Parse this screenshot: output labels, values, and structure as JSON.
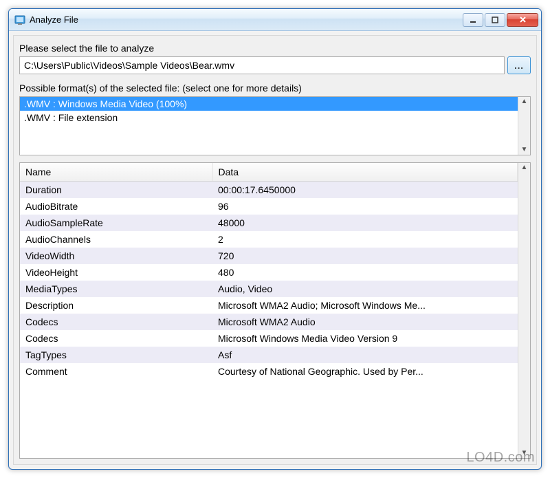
{
  "window": {
    "title": "Analyze File"
  },
  "labels": {
    "select_file": "Please select the file to analyze",
    "possible_formats": "Possible format(s) of the selected file: (select one for more details)"
  },
  "file_path": "C:\\Users\\Public\\Videos\\Sample Videos\\Bear.wmv",
  "browse_label": "...",
  "formats": [
    {
      "text": ".WMV : Windows Media Video (100%)",
      "selected": true
    },
    {
      "text": ".WMV : File extension",
      "selected": false
    }
  ],
  "table": {
    "columns": [
      "Name",
      "Data"
    ],
    "rows": [
      {
        "name": "Duration",
        "data": "00:00:17.6450000"
      },
      {
        "name": "AudioBitrate",
        "data": "96"
      },
      {
        "name": "AudioSampleRate",
        "data": "48000"
      },
      {
        "name": "AudioChannels",
        "data": "2"
      },
      {
        "name": "VideoWidth",
        "data": "720"
      },
      {
        "name": "VideoHeight",
        "data": "480"
      },
      {
        "name": "MediaTypes",
        "data": "Audio, Video"
      },
      {
        "name": "Description",
        "data": "Microsoft WMA2 Audio; Microsoft Windows Me..."
      },
      {
        "name": "Codecs",
        "data": "Microsoft WMA2 Audio"
      },
      {
        "name": "Codecs",
        "data": "Microsoft Windows Media Video Version 9"
      },
      {
        "name": "TagTypes",
        "data": "Asf"
      },
      {
        "name": "Comment",
        "data": "Courtesy of National Geographic.  Used by Per..."
      }
    ]
  },
  "watermark": "LO4D.com"
}
